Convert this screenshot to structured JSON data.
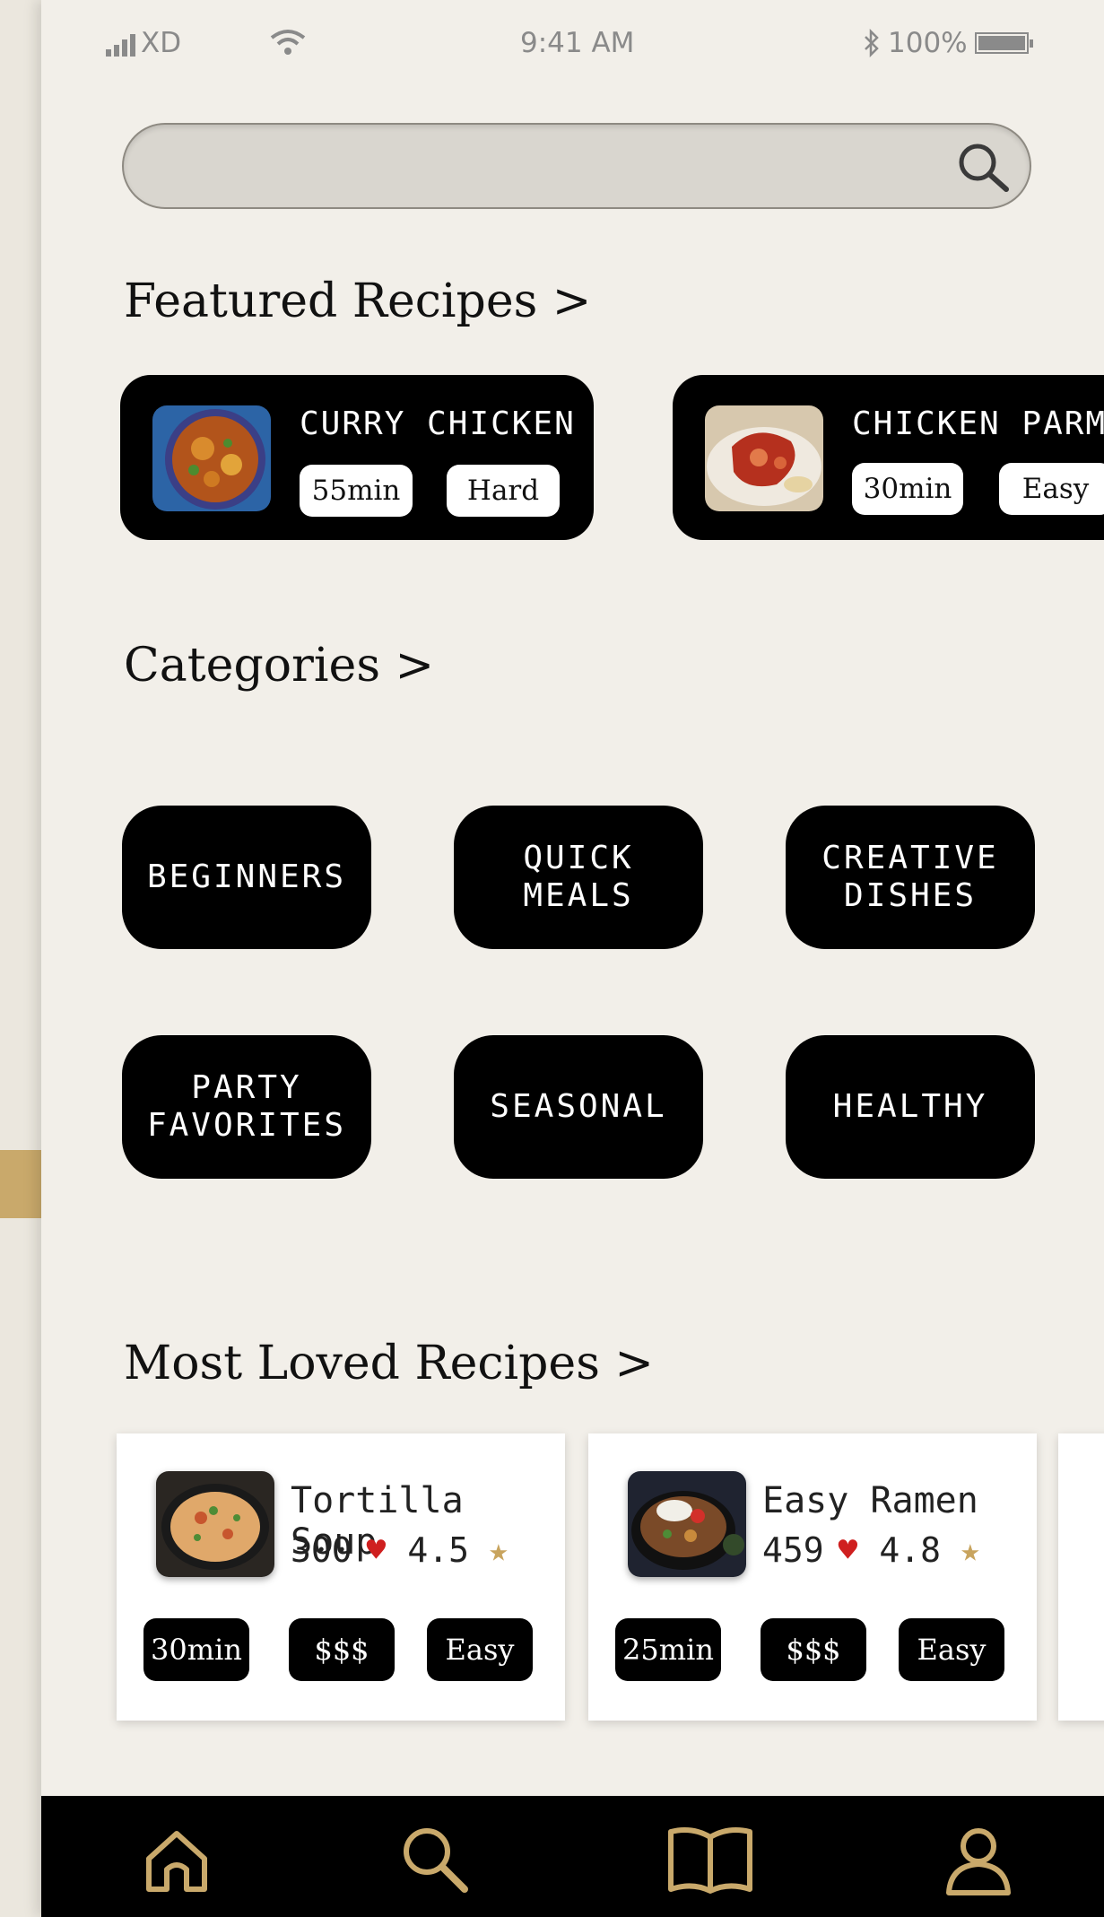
{
  "status": {
    "carrier": "XD",
    "time": "9:41 AM",
    "battery": "100%"
  },
  "search": {
    "placeholder": ""
  },
  "featured": {
    "title": "Featured Recipes >",
    "items": [
      {
        "name": "CURRY CHICKEN",
        "time": "55min",
        "difficulty": "Hard"
      },
      {
        "name": "CHICKEN PARM",
        "time": "30min",
        "difficulty": "Easy"
      }
    ]
  },
  "categories": {
    "title": "Categories >",
    "items": [
      {
        "line1": "BEGINNERS",
        "line2": ""
      },
      {
        "line1": "QUICK",
        "line2": "MEALS"
      },
      {
        "line1": "CREATIVE",
        "line2": "DISHES"
      },
      {
        "line1": "PARTY",
        "line2": "FAVORITES"
      },
      {
        "line1": "SEASONAL",
        "line2": ""
      },
      {
        "line1": "HEALTHY",
        "line2": ""
      }
    ]
  },
  "loved": {
    "title": "Most Loved Recipes >",
    "items": [
      {
        "name": "Tortilla Soup",
        "likes": "300",
        "rating": "4.5",
        "time": "30min",
        "cost": "$$$",
        "difficulty": "Easy"
      },
      {
        "name": "Easy Ramen",
        "likes": "459",
        "rating": "4.8",
        "time": "25min",
        "cost": "$$$",
        "difficulty": "Easy"
      }
    ]
  },
  "colors": {
    "accent_gold": "#c9a96b",
    "heart_red": "#cf1f1f",
    "star_gold": "#c8a45e"
  },
  "nav": {
    "icons": [
      "home-icon",
      "search-icon",
      "book-icon",
      "profile-icon"
    ]
  }
}
